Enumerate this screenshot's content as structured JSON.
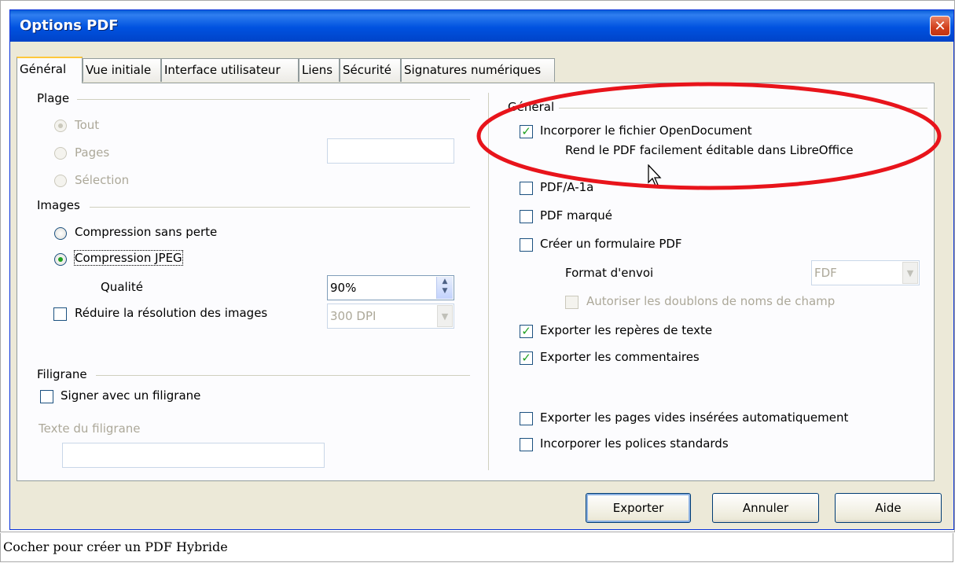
{
  "window": {
    "title": "Options PDF",
    "close_symbol": "✕"
  },
  "tabs": [
    "Général",
    "Vue initiale",
    "Interface utilisateur",
    "Liens",
    "Sécurité",
    "Signatures numériques"
  ],
  "left": {
    "range": {
      "title": "Plage",
      "all": "Tout",
      "pages": "Pages",
      "selection": "Sélection",
      "pages_value": ""
    },
    "images": {
      "title": "Images",
      "lossless": "Compression sans perte",
      "jpeg": "Compression JPEG",
      "quality_label": "Qualité",
      "quality_value": "90%",
      "reduce_label": "Réduire la résolution des images",
      "reduce_value": "300 DPI"
    },
    "watermark": {
      "title": "Filigrane",
      "sign_label": "Signer avec un filigrane",
      "text_label": "Texte du filigrane",
      "text_value": ""
    }
  },
  "right": {
    "title": "Général",
    "embed_label": "Incorporer le fichier OpenDocument",
    "embed_note": "Rend le PDF facilement éditable dans LibreOffice",
    "pdfa_label": "PDF/A-1a",
    "tagged_label": "PDF marqué",
    "form_label": "Créer un formulaire PDF",
    "submit_label": "Format d'envoi",
    "submit_value": "FDF",
    "duplicates_label": "Autoriser les doublons de noms de champ",
    "bookmarks_label": "Exporter les repères de texte",
    "comments_label": "Exporter les commentaires",
    "blank_pages_label": "Exporter les pages vides insérées automatiquement",
    "std_fonts_label": "Incorporer les polices standards"
  },
  "checked": {
    "embed": true,
    "pdfa": false,
    "tagged": false,
    "form": false,
    "duplicates": false,
    "bookmarks": true,
    "comments": true,
    "blank_pages": false,
    "std_fonts": false,
    "reduce": false,
    "sign": false
  },
  "buttons": {
    "export": "Exporter",
    "cancel": "Annuler",
    "help": "Aide"
  },
  "caption": "Cocher pour créer un PDF Hybride",
  "colors": {
    "highlight_ellipse": "#e8141b",
    "titlebar": "#0052e0",
    "check": "#21a121"
  },
  "check_symbol": "✓",
  "icons": [
    "close-icon",
    "spin-arrows-icon",
    "dropdown-arrow-icon",
    "mouse-cursor-icon"
  ]
}
